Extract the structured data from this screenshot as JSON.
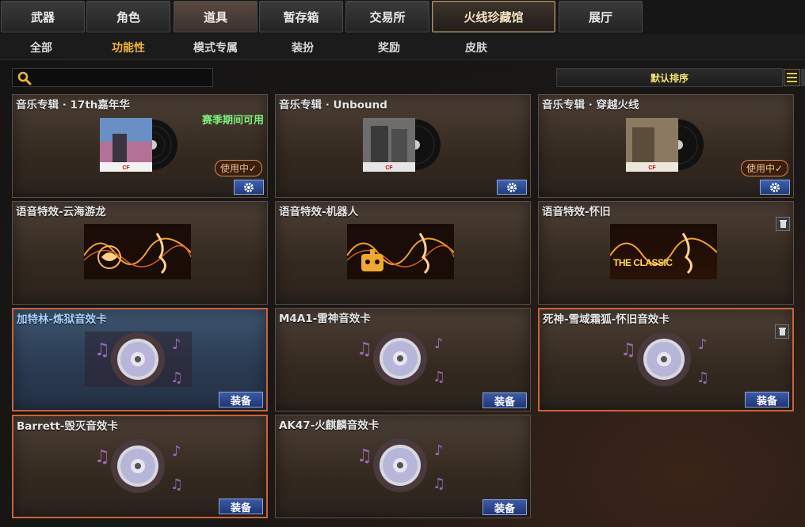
{
  "top_tabs": [
    {
      "label": "武器",
      "state": "normal"
    },
    {
      "label": "角色",
      "state": "normal"
    },
    {
      "label": "道具",
      "state": "active"
    },
    {
      "label": "暂存箱",
      "state": "normal"
    },
    {
      "label": "交易所",
      "state": "normal"
    },
    {
      "label": "火线珍藏馆",
      "state": "special"
    },
    {
      "label": "展厅",
      "state": "normal"
    }
  ],
  "sub_tabs": [
    {
      "label": "全部",
      "active": false
    },
    {
      "label": "功能性",
      "active": true
    },
    {
      "label": "模式专属",
      "active": false
    },
    {
      "label": "装扮",
      "active": false
    },
    {
      "label": "奖励",
      "active": false
    },
    {
      "label": "皮肤",
      "active": false
    }
  ],
  "search": {
    "value": "",
    "placeholder": ""
  },
  "sort": {
    "selected": "默认排序"
  },
  "cards": [
    {
      "title": "音乐专辑 · 17th嘉年华",
      "kind": "album",
      "season_note": "赛季期间可用",
      "in_use_label": "使用中✓",
      "button": "gear"
    },
    {
      "title": "音乐专辑 · Unbound",
      "kind": "album",
      "button": "gear"
    },
    {
      "title": "音乐专辑 · 穿越火线",
      "kind": "album",
      "in_use_label": "使用中✓",
      "button": "gear"
    },
    {
      "title": "语音特效-云海游龙",
      "kind": "voice",
      "icon": "dragon-icon"
    },
    {
      "title": "语音特效-机器人",
      "kind": "voice",
      "icon": "robot-icon"
    },
    {
      "title": "语音特效-怀旧",
      "kind": "voice",
      "icon_text": "THE CLASSIC",
      "trash": true
    },
    {
      "title": "加特林-炼狱音效卡",
      "kind": "disc",
      "button": "equip",
      "equip_label": "装备",
      "state": "selected"
    },
    {
      "title": "M4A1-雷神音效卡",
      "kind": "disc",
      "button": "equip",
      "equip_label": "装备"
    },
    {
      "title": "死神-雪域霜狐-怀旧音效卡",
      "kind": "disc",
      "button": "equip",
      "equip_label": "装备",
      "trash": true,
      "state": "highlight"
    },
    {
      "title": "Barrett-毁灭音效卡",
      "kind": "disc",
      "button": "equip",
      "equip_label": "装备",
      "state": "highlight"
    },
    {
      "title": "AK47-火麒麟音效卡",
      "kind": "disc",
      "button": "equip",
      "equip_label": "装备"
    }
  ],
  "colors": {
    "active_subtab": "#f0b33a",
    "season_note": "#7cf07c",
    "sort_text": "#f6e26c",
    "equip_button": "#2c48a0",
    "highlight_border": "#c8643a"
  }
}
